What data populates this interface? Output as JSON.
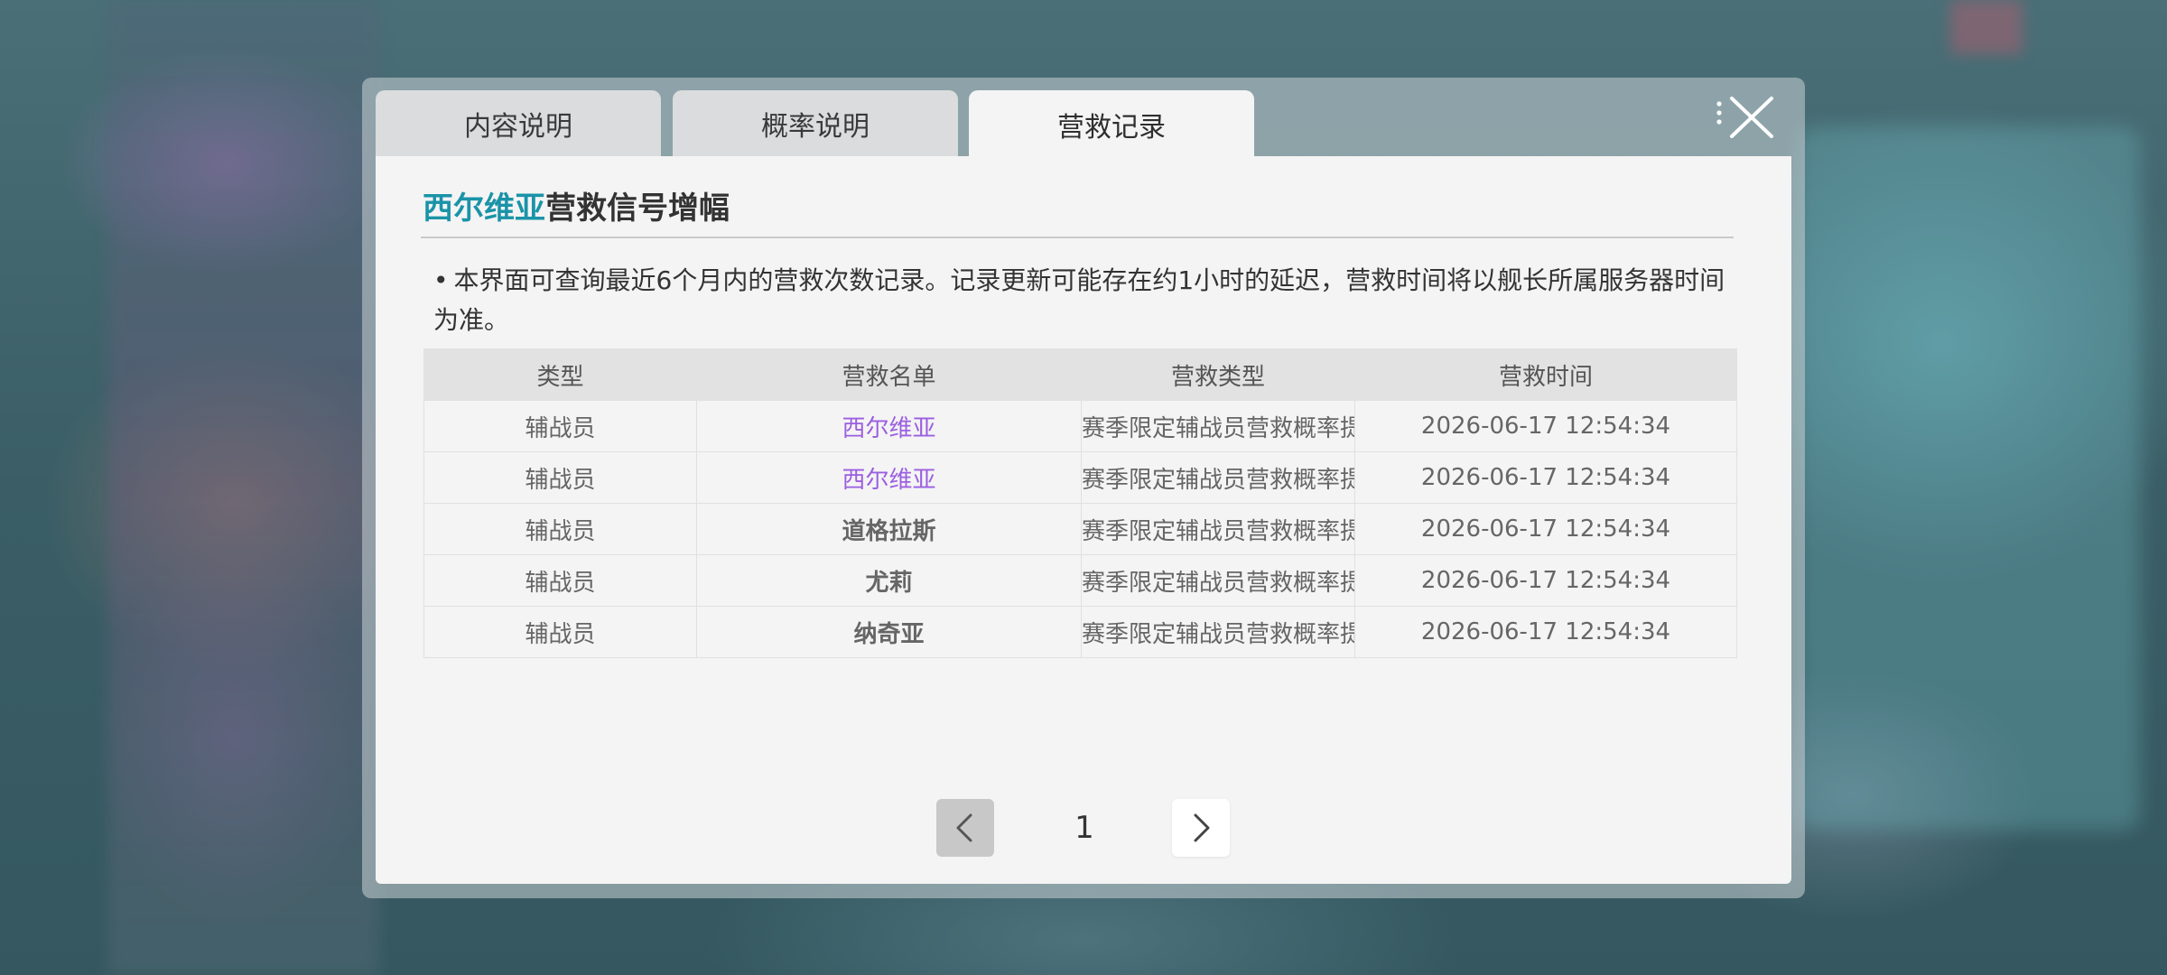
{
  "tabs": [
    {
      "label": "内容说明",
      "active": false
    },
    {
      "label": "概率说明",
      "active": false
    },
    {
      "label": "营救记录",
      "active": true
    }
  ],
  "title": {
    "highlight": "西尔维亚",
    "rest": "营救信号增幅"
  },
  "notice": {
    "bullet": "•",
    "text": "本界面可查询最近6个月内的营救次数记录。记录更新可能存在约1小时的延迟，营救时间将以舰长所属服务器时间为准。"
  },
  "table": {
    "headers": [
      "类型",
      "营救名单",
      "营救类型",
      "营救时间"
    ],
    "rows": [
      {
        "type": "辅战员",
        "name": "西尔维亚",
        "name_highlight": true,
        "rescue_type": "赛季限定辅战员营救概率提升",
        "time": "2026-06-17 12:54:34"
      },
      {
        "type": "辅战员",
        "name": "西尔维亚",
        "name_highlight": true,
        "rescue_type": "赛季限定辅战员营救概率提升",
        "time": "2026-06-17 12:54:34"
      },
      {
        "type": "辅战员",
        "name": "道格拉斯",
        "name_highlight": false,
        "rescue_type": "赛季限定辅战员营救概率提升",
        "time": "2026-06-17 12:54:34"
      },
      {
        "type": "辅战员",
        "name": "尤莉",
        "name_highlight": false,
        "rescue_type": "赛季限定辅战员营救概率提升",
        "time": "2026-06-17 12:54:34"
      },
      {
        "type": "辅战员",
        "name": "纳奇亚",
        "name_highlight": false,
        "rescue_type": "赛季限定辅战员营救概率提升",
        "time": "2026-06-17 12:54:34"
      }
    ]
  },
  "pager": {
    "current_page": "1"
  },
  "colors": {
    "accent_title": "#1a93a8",
    "highlight_name": "#9b5fe0"
  },
  "icons": {
    "close": "close-icon",
    "prev": "chevron-left-icon",
    "next": "chevron-right-icon"
  }
}
